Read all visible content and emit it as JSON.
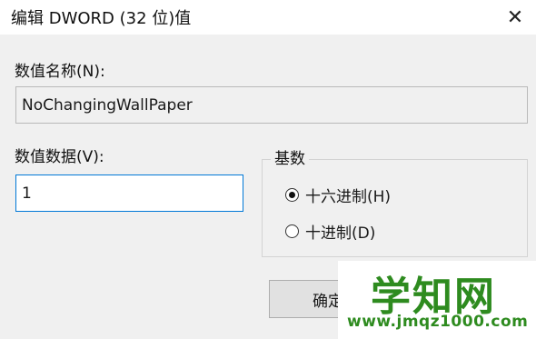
{
  "window": {
    "title": "编辑 DWORD (32 位)值",
    "close_glyph": "✕"
  },
  "form": {
    "name_label": "数值名称(N):",
    "name_value": "NoChangingWallPaper",
    "data_label": "数值数据(V):",
    "data_value": "1",
    "base_label": "基数",
    "base_options": [
      {
        "label": "十六进制(H)",
        "checked": true
      },
      {
        "label": "十进制(D)",
        "checked": false
      }
    ]
  },
  "buttons": {
    "ok_label": "确定"
  },
  "watermark": {
    "main": "学知网",
    "url": "www.jmqz1000.com"
  }
}
